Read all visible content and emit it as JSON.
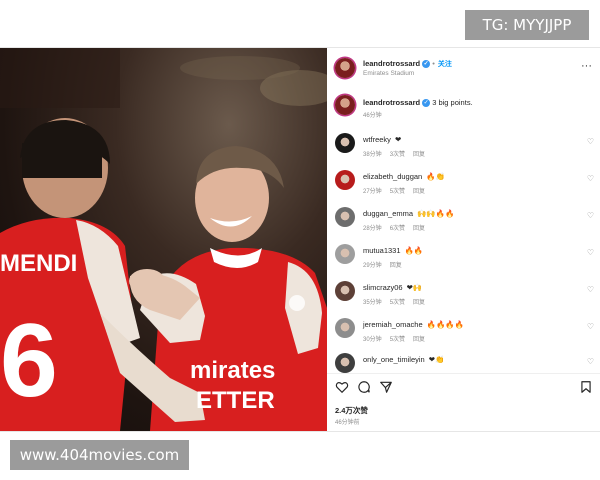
{
  "watermark_top": "TG: MYYJJPP",
  "watermark_bottom": "www.404movies.com",
  "post": {
    "author": "leandrotrossard",
    "follow_label": "关注",
    "location": "Emirates Stadium",
    "more_label": "···",
    "caption_author": "leandrotrossard",
    "caption_text": "3 big points.",
    "caption_time": "46分钟",
    "jersey_left_name": "MENDI",
    "jersey_left_number": "6",
    "jersey_right_sponsor_1": "mirates",
    "jersey_right_sponsor_2": "ETTER"
  },
  "comments": [
    {
      "user": "wtfreeky",
      "emoji": "❤",
      "time": "38分钟",
      "likes": "3次赞",
      "reply": "回复",
      "avatar_color": "#1a1a1a"
    },
    {
      "user": "elizabeth_duggan",
      "emoji": "🔥👏",
      "time": "27分钟",
      "likes": "5次赞",
      "reply": "回复",
      "avatar_color": "#b71c1c"
    },
    {
      "user": "duggan_emma",
      "emoji": "🙌🙌🔥🔥",
      "time": "28分钟",
      "likes": "6次赞",
      "reply": "回复",
      "avatar_color": "#6d6d6d"
    },
    {
      "user": "mutua1331",
      "emoji": "🔥🔥",
      "time": "29分钟",
      "likes": "",
      "reply": "回复",
      "avatar_color": "#9e9e9e"
    },
    {
      "user": "slimcrazy06",
      "emoji": "❤🙌",
      "time": "35分钟",
      "likes": "5次赞",
      "reply": "回复",
      "avatar_color": "#5d4037"
    },
    {
      "user": "jeremiah_omache",
      "emoji": "🔥🔥🔥🔥",
      "time": "30分钟",
      "likes": "5次赞",
      "reply": "回复",
      "avatar_color": "#8d8d8d"
    },
    {
      "user": "only_one_timileyin",
      "emoji": "❤👏",
      "time": "",
      "likes": "",
      "reply": "",
      "avatar_color": "#3e3e3e"
    }
  ],
  "actions": {
    "likes_count": "2.4万次赞",
    "post_time": "46分钟前",
    "icons": [
      "heart-icon",
      "comment-icon",
      "share-icon",
      "bookmark-icon"
    ]
  },
  "colors": {
    "jersey_red": "#d81f1f",
    "jersey_white": "#f2ece6",
    "verified_blue": "#3897f0",
    "follow_blue": "#0095f6",
    "watermark_gray": "#9b9b9b"
  }
}
